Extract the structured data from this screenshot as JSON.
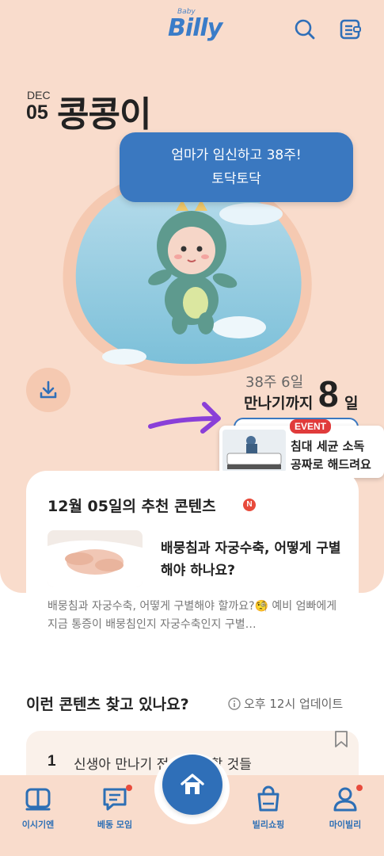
{
  "header": {
    "logo_small": "Baby",
    "logo_text": "Billy",
    "search_icon": "search-icon",
    "menu_icon": "book-menu-icon"
  },
  "baby": {
    "month": "DEC",
    "day": "05",
    "name": "콩콩이"
  },
  "speech_bubble": {
    "line1": "엄마가 임신하고 38주!",
    "line2": "토닥토닥"
  },
  "status": {
    "week": "38주 6일",
    "meet_label": "만나기까지",
    "dday": "8",
    "dday_unit": "일"
  },
  "event_banner": {
    "badge": "EVENT",
    "line1": "침대 세균 소독",
    "line2": "공짜로 해드려요"
  },
  "recommend": {
    "title": "12월 05일의 추천 콘텐츠",
    "new_badge": "N",
    "article_title": "배뭉침과 자궁수축, 어떻게 구별해야 하나요?",
    "article_desc": "배뭉침과 자궁수축, 어떻게 구별해야 할까요?🧐 예비 엄빠에게 지금 통증이 배뭉침인지 자궁수축인지 구별…"
  },
  "search_section": {
    "title": "이런 콘텐츠 찾고 있나요?",
    "update": "오후 12시 업데이트",
    "items": [
      {
        "rank": "1",
        "text": "신생아 만나기 전 챙겨야할 것들"
      }
    ]
  },
  "nav": {
    "items": [
      {
        "label": "이시기엔",
        "icon": "book-open-icon"
      },
      {
        "label": "베동 모임",
        "icon": "chat-icon"
      },
      {
        "label": "",
        "icon": "home-icon"
      },
      {
        "label": "빌리쇼핑",
        "icon": "shopping-bag-icon"
      },
      {
        "label": "마이빌리",
        "icon": "person-icon"
      }
    ]
  },
  "colors": {
    "background": "#f9dccc",
    "accent": "#3a78c0",
    "badge": "#e84b3c"
  }
}
